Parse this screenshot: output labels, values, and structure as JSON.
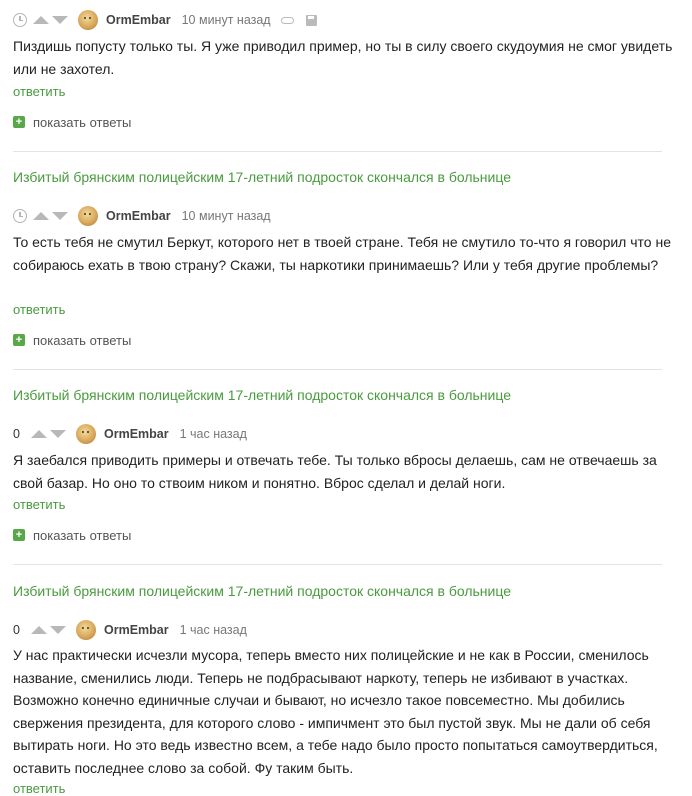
{
  "comments": [
    {
      "score": "",
      "author": "OrmEmbar",
      "time": "10 минут назад",
      "text": "Пиздишь попусту только ты. Я уже приводил пример, но ты в силу своего скудоумия не смог увидеть или не захотел.",
      "reply_label": "ответить",
      "show_replies_label": "показать ответы"
    },
    {
      "score": "",
      "author": "OrmEmbar",
      "time": "10 минут назад",
      "text": "То есть тебя не смутил Беркут, которого нет в твоей стране. Тебя не смутило то-что я говорил что не собираюсь ехать в твою страну? Скажи, ты наркотики принимаешь? Или у тебя другие проблемы?",
      "reply_label": "ответить",
      "show_replies_label": "показать ответы"
    },
    {
      "score": "0",
      "author": "OrmEmbar",
      "time": "1 час назад",
      "text": "Я заебался приводить примеры и отвечать тебе. Ты только вбросы делаешь, сам не отвечаешь за свой базар. Но оно то ствоим ником и понятно. Вброс сделал и делай ноги.",
      "reply_label": "ответить",
      "show_replies_label": "показать ответы"
    },
    {
      "score": "0",
      "author": "OrmEmbar",
      "time": "1 час назад",
      "text": "У нас практически исчезли мусора, теперь вместо них полицейские и не как в России, сменилось название, сменились люди. Теперь не подбрасывают наркоту, теперь не избивают в участках. Возможно конечно единичные случаи и бывают, но исчезло такое повсеместно. Мы добились свержения президента, для которого слово - импичмент это был пустой звук. Мы не дали об себя вытирать ноги. Но это ведь известно всем, а тебе надо было просто попытаться самоутвердиться, оставить последнее слово за собой. Фу таким быть.",
      "reply_label": "ответить"
    }
  ],
  "story_titles": [
    "Избитый брянским полицейским 17-летний подросток скончался в больнице",
    "Избитый брянским полицейским 17-летний подросток скончался в больнице",
    "Избитый брянским полицейским 17-летний подросток скончался в больнице"
  ],
  "colors": {
    "accent": "#4a9a3f",
    "plus": "#58a84a",
    "icon_gray": "#b8b8b8"
  },
  "icons": [
    "clock-icon",
    "upvote-arrow-icon",
    "downvote-arrow-icon",
    "avatar-doge",
    "link-icon",
    "save-icon",
    "plus-icon"
  ]
}
